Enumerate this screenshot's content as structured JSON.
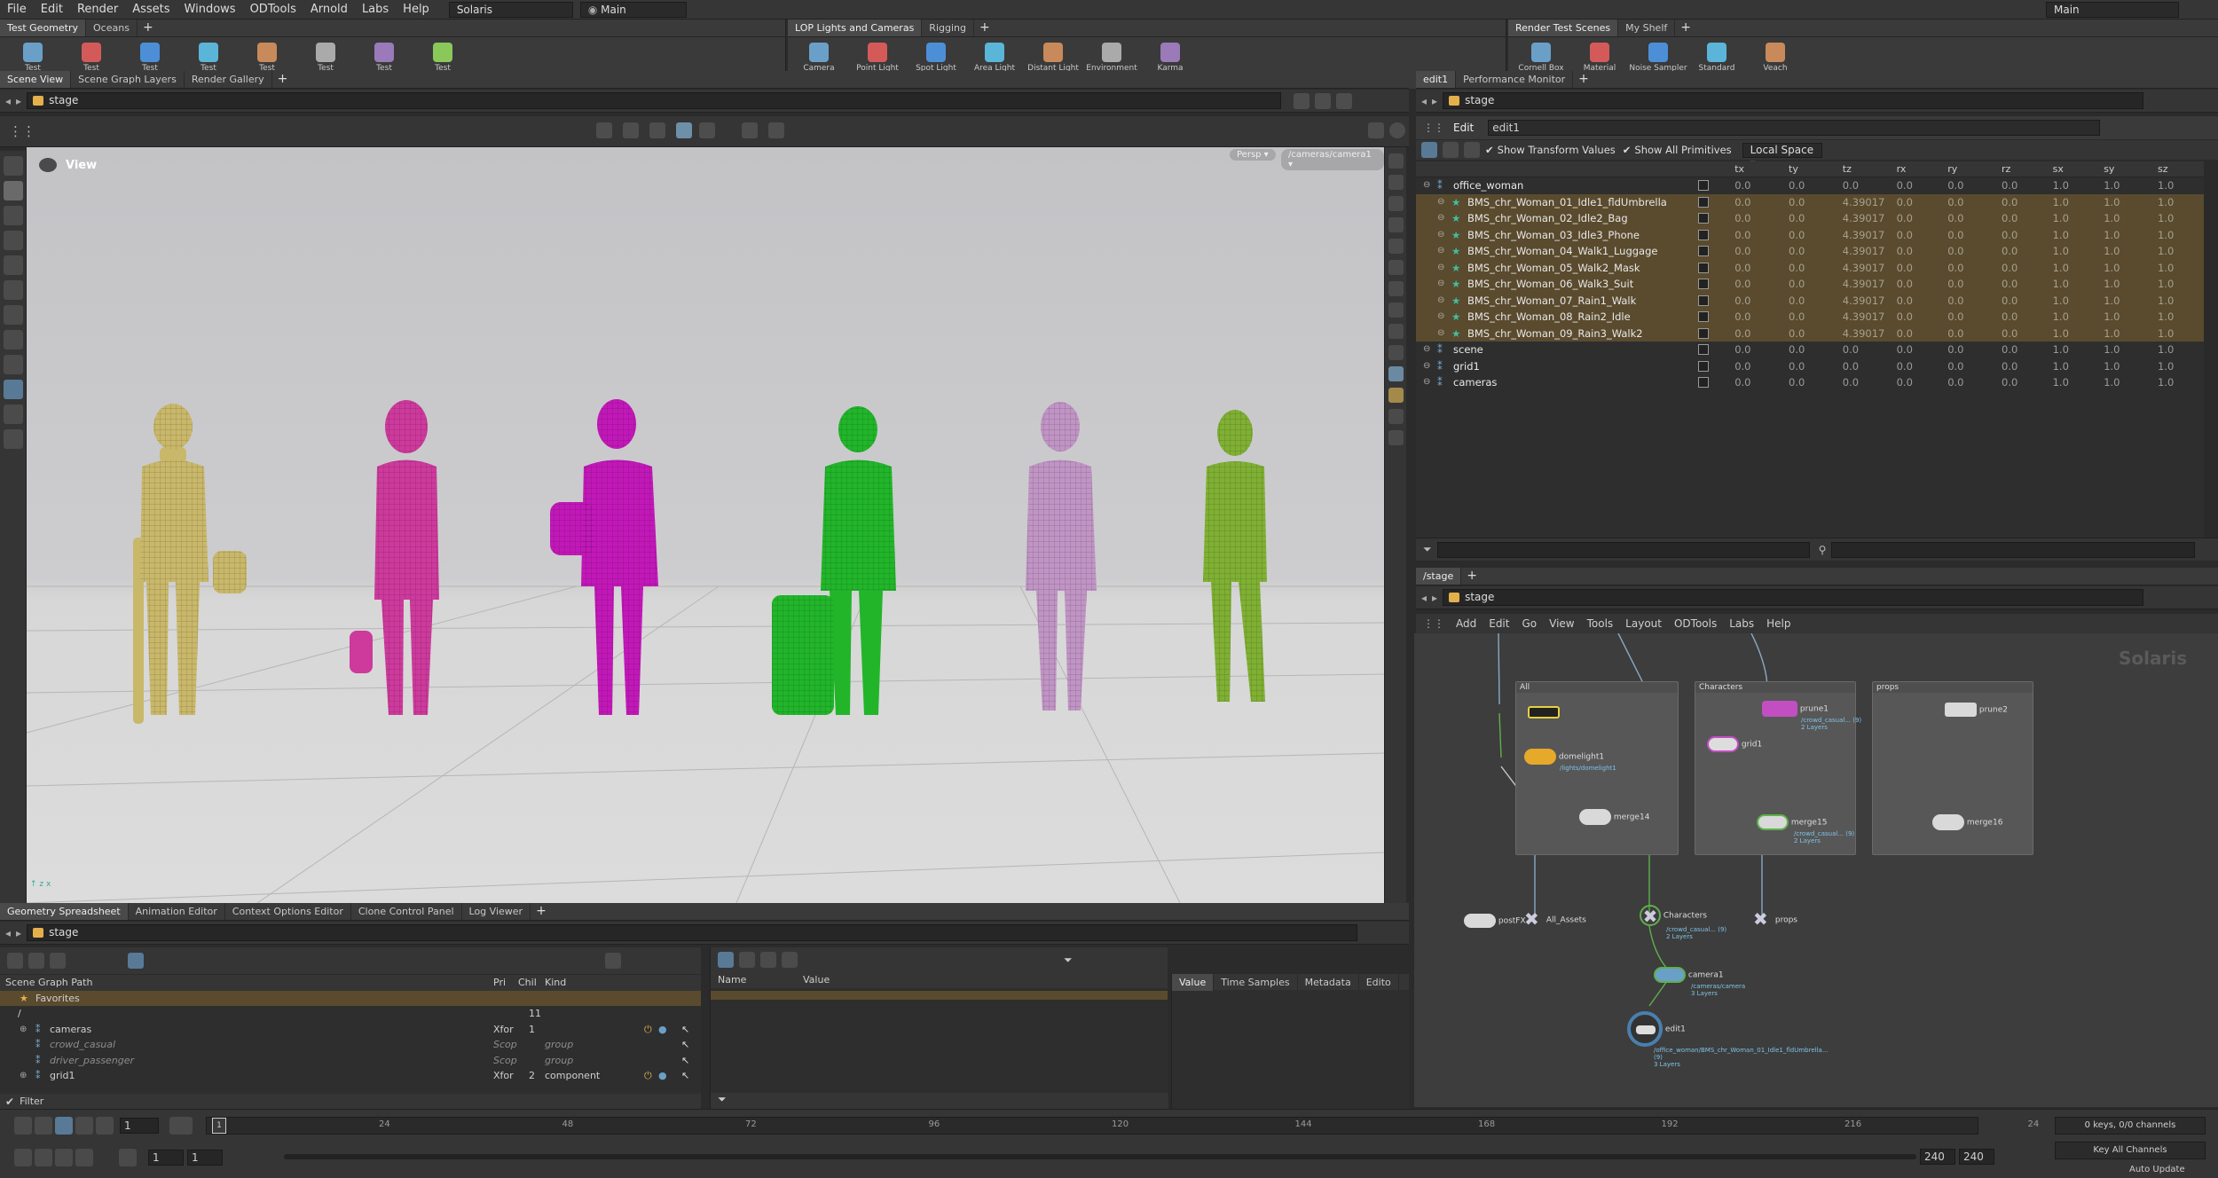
{
  "menubar": {
    "items": [
      "File",
      "Edit",
      "Render",
      "Assets",
      "Windows",
      "ODTools",
      "Arnold",
      "Labs",
      "Help"
    ],
    "desktop": "Solaris",
    "context": "Main",
    "right_context": "Main"
  },
  "shelves": {
    "left": {
      "tabs": [
        "Test Geometry",
        "Oceans"
      ],
      "tools": [
        "Test\nGeometry: C...",
        "Test\nGeometry: P...",
        "Test\nGeometry: R...",
        "Test\nGeometry: S...",
        "Test\nGeometry: S...",
        "Test\nGeometry: T...",
        "Test\nGeometry: T...",
        "Test\nGeometry: T..."
      ]
    },
    "mid": {
      "tabs": [
        "LOP Lights and Cameras",
        "Rigging"
      ],
      "tools": [
        "Camera",
        "Point Light",
        "Spot Light",
        "Area Light",
        "Distant Light",
        "Environment\nLight",
        "Karma\nPhysical Sky"
      ]
    },
    "right": {
      "tabs": [
        "Render Test Scenes",
        "My Shelf"
      ],
      "tools": [
        "Cornell Box",
        "Material\nLookdev",
        "Noise Sampler",
        "Standard\nShader Ball",
        "Veach\nMis Planks"
      ]
    }
  },
  "viewer": {
    "tabs": [
      "Scene View",
      "Scene Graph Layers",
      "Render Gallery"
    ],
    "path": "stage",
    "title": "View",
    "persp": "Persp",
    "camera": "/cameras/camera1"
  },
  "edit_panel": {
    "tabs": [
      "edit1",
      "Performance Monitor"
    ],
    "path": "stage",
    "node_type": "Edit",
    "node_name": "edit1",
    "show_transform": "Show Transform Values",
    "show_all": "Show All Primitives",
    "space": "Local Space",
    "columns": [
      "tx",
      "ty",
      "tz",
      "rx",
      "ry",
      "rz",
      "sx",
      "sy",
      "sz"
    ],
    "rows": [
      {
        "name": "office_woman",
        "level": 0,
        "vals": [
          "0.0",
          "0.0",
          "0.0",
          "0.0",
          "0.0",
          "0.0",
          "1.0",
          "1.0",
          "1.0"
        ],
        "sel": false
      },
      {
        "name": "BMS_chr_Woman_01_Idle1_fldUmbrella",
        "level": 1,
        "vals": [
          "0.0",
          "0.0",
          "4.39017",
          "0.0",
          "0.0",
          "0.0",
          "1.0",
          "1.0",
          "1.0"
        ],
        "sel": true
      },
      {
        "name": "BMS_chr_Woman_02_Idle2_Bag",
        "level": 1,
        "vals": [
          "0.0",
          "0.0",
          "4.39017",
          "0.0",
          "0.0",
          "0.0",
          "1.0",
          "1.0",
          "1.0"
        ],
        "sel": true
      },
      {
        "name": "BMS_chr_Woman_03_Idle3_Phone",
        "level": 1,
        "vals": [
          "0.0",
          "0.0",
          "4.39017",
          "0.0",
          "0.0",
          "0.0",
          "1.0",
          "1.0",
          "1.0"
        ],
        "sel": true
      },
      {
        "name": "BMS_chr_Woman_04_Walk1_Luggage",
        "level": 1,
        "vals": [
          "0.0",
          "0.0",
          "4.39017",
          "0.0",
          "0.0",
          "0.0",
          "1.0",
          "1.0",
          "1.0"
        ],
        "sel": true
      },
      {
        "name": "BMS_chr_Woman_05_Walk2_Mask",
        "level": 1,
        "vals": [
          "0.0",
          "0.0",
          "4.39017",
          "0.0",
          "0.0",
          "0.0",
          "1.0",
          "1.0",
          "1.0"
        ],
        "sel": true
      },
      {
        "name": "BMS_chr_Woman_06_Walk3_Suit",
        "level": 1,
        "vals": [
          "0.0",
          "0.0",
          "4.39017",
          "0.0",
          "0.0",
          "0.0",
          "1.0",
          "1.0",
          "1.0"
        ],
        "sel": true
      },
      {
        "name": "BMS_chr_Woman_07_Rain1_Walk",
        "level": 1,
        "vals": [
          "0.0",
          "0.0",
          "4.39017",
          "0.0",
          "0.0",
          "0.0",
          "1.0",
          "1.0",
          "1.0"
        ],
        "sel": true
      },
      {
        "name": "BMS_chr_Woman_08_Rain2_Idle",
        "level": 1,
        "vals": [
          "0.0",
          "0.0",
          "4.39017",
          "0.0",
          "0.0",
          "0.0",
          "1.0",
          "1.0",
          "1.0"
        ],
        "sel": true
      },
      {
        "name": "BMS_chr_Woman_09_Rain3_Walk2",
        "level": 1,
        "vals": [
          "0.0",
          "0.0",
          "4.39017",
          "0.0",
          "0.0",
          "0.0",
          "1.0",
          "1.0",
          "1.0"
        ],
        "sel": true
      },
      {
        "name": "scene",
        "level": 0,
        "vals": [
          "0.0",
          "0.0",
          "0.0",
          "0.0",
          "0.0",
          "0.0",
          "1.0",
          "1.0",
          "1.0"
        ],
        "sel": false
      },
      {
        "name": "grid1",
        "level": 0,
        "vals": [
          "0.0",
          "0.0",
          "0.0",
          "0.0",
          "0.0",
          "0.0",
          "1.0",
          "1.0",
          "1.0"
        ],
        "sel": false
      },
      {
        "name": "cameras",
        "level": 0,
        "vals": [
          "0.0",
          "0.0",
          "0.0",
          "0.0",
          "0.0",
          "0.0",
          "1.0",
          "1.0",
          "1.0"
        ],
        "sel": false
      }
    ]
  },
  "network": {
    "pane": "/stage",
    "path": "stage",
    "menu": [
      "Add",
      "Edit",
      "Go",
      "View",
      "Tools",
      "Layout",
      "ODTools",
      "Labs",
      "Help"
    ],
    "watermark": "Solaris",
    "boxes": [
      "All",
      "Characters",
      "props"
    ],
    "nodes": {
      "domelight": "domelight1",
      "domelight_sub": "/lights/domelight1",
      "merge14": "merge14",
      "prune1": "prune1",
      "prune1_sub": "/crowd_casual... (9)",
      "prune1_layers": "2 Layers",
      "grid1": "grid1",
      "merge15": "merge15",
      "merge15_sub": "/crowd_casual... (9)",
      "merge15_layers": "2 Layers",
      "prune2": "prune2",
      "merge16": "merge16",
      "postfx": "postFX",
      "all_assets": "All_Assets",
      "characters": "Characters",
      "characters_sub": "/crowd_casual... (9)",
      "characters_layers": "2 Layers",
      "props": "props",
      "camera1": "camera1",
      "camera1_sub": "/cameras/camera",
      "camera1_layers": "3 Layers",
      "edit1": "edit1",
      "edit1_sub": "/office_woman/BMS_chr_Woman_01_Idle1_fldUmbrella... (9)",
      "edit1_layers": "3 Layers"
    }
  },
  "bottom": {
    "tabs": [
      "Geometry Spreadsheet",
      "Animation Editor",
      "Context Options Editor",
      "Clone Control Panel",
      "Log Viewer"
    ],
    "path": "stage",
    "sg_headers": [
      "Scene Graph Path",
      "Pri",
      "Chil",
      "Kind"
    ],
    "favorites": "Favorites",
    "root": "/",
    "root_count": "11",
    "items": [
      {
        "name": "cameras",
        "type": "Xfor",
        "chil": "1",
        "kind": "",
        "italic": false
      },
      {
        "name": "crowd_casual",
        "type": "Scop",
        "chil": "",
        "kind": "group",
        "italic": true
      },
      {
        "name": "driver_passenger",
        "type": "Scop",
        "chil": "",
        "kind": "group",
        "italic": true
      },
      {
        "name": "grid1",
        "type": "Xfor",
        "chil": "2",
        "kind": "component",
        "italic": false
      }
    ],
    "filter": "Filter",
    "props_headers": [
      "Name",
      "Value"
    ],
    "value_tabs": [
      "Value",
      "Time Samples",
      "Metadata",
      "Edito"
    ]
  },
  "playbar": {
    "frame": "1",
    "start": "1",
    "start2": "1",
    "end": "240",
    "end2": "240",
    "ticks": [
      "24",
      "48",
      "72",
      "96",
      "120",
      "144",
      "168",
      "192",
      "216",
      "24"
    ],
    "keys": "0 keys, 0/0 channels",
    "key_all": "Key All Channels",
    "auto_update": "Auto Update"
  }
}
